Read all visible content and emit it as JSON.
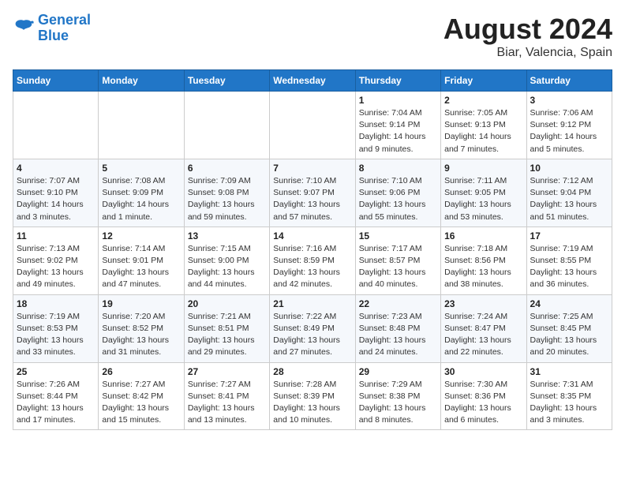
{
  "header": {
    "logo_line1": "General",
    "logo_line2": "Blue",
    "month_year": "August 2024",
    "location": "Biar, Valencia, Spain"
  },
  "weekdays": [
    "Sunday",
    "Monday",
    "Tuesday",
    "Wednesday",
    "Thursday",
    "Friday",
    "Saturday"
  ],
  "weeks": [
    [
      {
        "day": "",
        "info": ""
      },
      {
        "day": "",
        "info": ""
      },
      {
        "day": "",
        "info": ""
      },
      {
        "day": "",
        "info": ""
      },
      {
        "day": "1",
        "info": "Sunrise: 7:04 AM\nSunset: 9:14 PM\nDaylight: 14 hours\nand 9 minutes."
      },
      {
        "day": "2",
        "info": "Sunrise: 7:05 AM\nSunset: 9:13 PM\nDaylight: 14 hours\nand 7 minutes."
      },
      {
        "day": "3",
        "info": "Sunrise: 7:06 AM\nSunset: 9:12 PM\nDaylight: 14 hours\nand 5 minutes."
      }
    ],
    [
      {
        "day": "4",
        "info": "Sunrise: 7:07 AM\nSunset: 9:10 PM\nDaylight: 14 hours\nand 3 minutes."
      },
      {
        "day": "5",
        "info": "Sunrise: 7:08 AM\nSunset: 9:09 PM\nDaylight: 14 hours\nand 1 minute."
      },
      {
        "day": "6",
        "info": "Sunrise: 7:09 AM\nSunset: 9:08 PM\nDaylight: 13 hours\nand 59 minutes."
      },
      {
        "day": "7",
        "info": "Sunrise: 7:10 AM\nSunset: 9:07 PM\nDaylight: 13 hours\nand 57 minutes."
      },
      {
        "day": "8",
        "info": "Sunrise: 7:10 AM\nSunset: 9:06 PM\nDaylight: 13 hours\nand 55 minutes."
      },
      {
        "day": "9",
        "info": "Sunrise: 7:11 AM\nSunset: 9:05 PM\nDaylight: 13 hours\nand 53 minutes."
      },
      {
        "day": "10",
        "info": "Sunrise: 7:12 AM\nSunset: 9:04 PM\nDaylight: 13 hours\nand 51 minutes."
      }
    ],
    [
      {
        "day": "11",
        "info": "Sunrise: 7:13 AM\nSunset: 9:02 PM\nDaylight: 13 hours\nand 49 minutes."
      },
      {
        "day": "12",
        "info": "Sunrise: 7:14 AM\nSunset: 9:01 PM\nDaylight: 13 hours\nand 47 minutes."
      },
      {
        "day": "13",
        "info": "Sunrise: 7:15 AM\nSunset: 9:00 PM\nDaylight: 13 hours\nand 44 minutes."
      },
      {
        "day": "14",
        "info": "Sunrise: 7:16 AM\nSunset: 8:59 PM\nDaylight: 13 hours\nand 42 minutes."
      },
      {
        "day": "15",
        "info": "Sunrise: 7:17 AM\nSunset: 8:57 PM\nDaylight: 13 hours\nand 40 minutes."
      },
      {
        "day": "16",
        "info": "Sunrise: 7:18 AM\nSunset: 8:56 PM\nDaylight: 13 hours\nand 38 minutes."
      },
      {
        "day": "17",
        "info": "Sunrise: 7:19 AM\nSunset: 8:55 PM\nDaylight: 13 hours\nand 36 minutes."
      }
    ],
    [
      {
        "day": "18",
        "info": "Sunrise: 7:19 AM\nSunset: 8:53 PM\nDaylight: 13 hours\nand 33 minutes."
      },
      {
        "day": "19",
        "info": "Sunrise: 7:20 AM\nSunset: 8:52 PM\nDaylight: 13 hours\nand 31 minutes."
      },
      {
        "day": "20",
        "info": "Sunrise: 7:21 AM\nSunset: 8:51 PM\nDaylight: 13 hours\nand 29 minutes."
      },
      {
        "day": "21",
        "info": "Sunrise: 7:22 AM\nSunset: 8:49 PM\nDaylight: 13 hours\nand 27 minutes."
      },
      {
        "day": "22",
        "info": "Sunrise: 7:23 AM\nSunset: 8:48 PM\nDaylight: 13 hours\nand 24 minutes."
      },
      {
        "day": "23",
        "info": "Sunrise: 7:24 AM\nSunset: 8:47 PM\nDaylight: 13 hours\nand 22 minutes."
      },
      {
        "day": "24",
        "info": "Sunrise: 7:25 AM\nSunset: 8:45 PM\nDaylight: 13 hours\nand 20 minutes."
      }
    ],
    [
      {
        "day": "25",
        "info": "Sunrise: 7:26 AM\nSunset: 8:44 PM\nDaylight: 13 hours\nand 17 minutes."
      },
      {
        "day": "26",
        "info": "Sunrise: 7:27 AM\nSunset: 8:42 PM\nDaylight: 13 hours\nand 15 minutes."
      },
      {
        "day": "27",
        "info": "Sunrise: 7:27 AM\nSunset: 8:41 PM\nDaylight: 13 hours\nand 13 minutes."
      },
      {
        "day": "28",
        "info": "Sunrise: 7:28 AM\nSunset: 8:39 PM\nDaylight: 13 hours\nand 10 minutes."
      },
      {
        "day": "29",
        "info": "Sunrise: 7:29 AM\nSunset: 8:38 PM\nDaylight: 13 hours\nand 8 minutes."
      },
      {
        "day": "30",
        "info": "Sunrise: 7:30 AM\nSunset: 8:36 PM\nDaylight: 13 hours\nand 6 minutes."
      },
      {
        "day": "31",
        "info": "Sunrise: 7:31 AM\nSunset: 8:35 PM\nDaylight: 13 hours\nand 3 minutes."
      }
    ]
  ]
}
